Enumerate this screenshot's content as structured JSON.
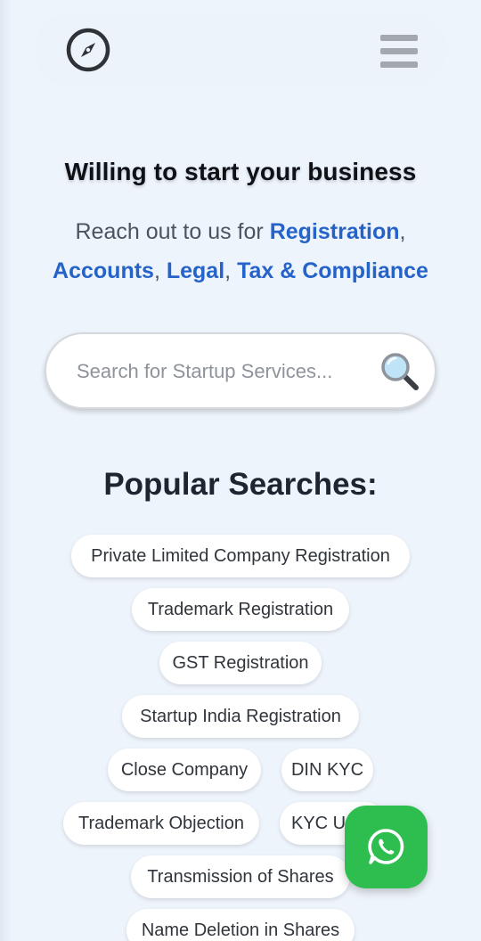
{
  "header": {
    "logo_icon": "compass-icon",
    "menu_icon": "hamburger-menu-icon"
  },
  "hero": {
    "headline": "Willing to start your business",
    "subline_prefix": "Reach out to us for ",
    "services": [
      "Registration",
      "Accounts",
      "Legal",
      "Tax & Compliance"
    ],
    "separator": ", "
  },
  "search": {
    "placeholder": "Search for Startup Services...",
    "value": "",
    "icon": "magnifier-icon"
  },
  "popular": {
    "title": "Popular Searches:",
    "chips": [
      "Private Limited Company Registration",
      "Trademark Registration",
      "GST Registration",
      "Startup India Registration",
      "Close Company",
      "DIN KYC",
      "Trademark Objection",
      "KYC Up",
      "Transmission of Shares",
      "Name Deletion in Shares"
    ]
  },
  "floating": {
    "whatsapp_icon": "whatsapp-icon"
  },
  "colors": {
    "accent": "#2563c9",
    "whatsapp": "#2dbe4f",
    "background": "#eef4fc"
  }
}
